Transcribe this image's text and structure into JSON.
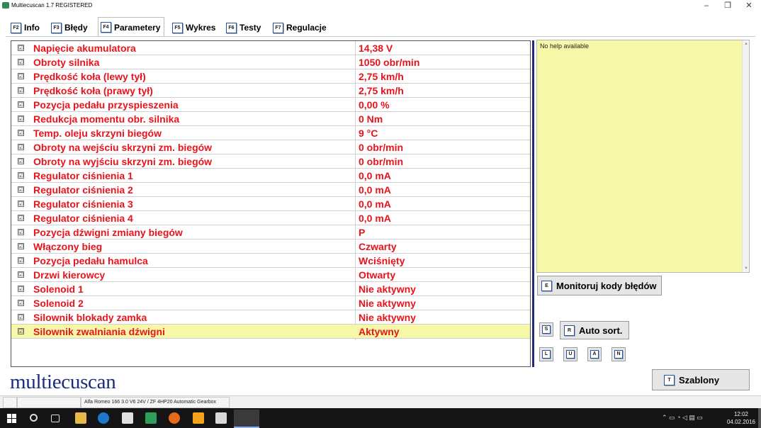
{
  "window": {
    "title": "Multiecuscan 1.7 REGISTERED",
    "minimize": "–",
    "maximize": "❐",
    "close": "✕"
  },
  "tabs": [
    {
      "key": "F2",
      "label": "Info"
    },
    {
      "key": "F3",
      "label": "Błędy"
    },
    {
      "key": "F4",
      "label": "Parametery"
    },
    {
      "key": "F5",
      "label": "Wykres"
    },
    {
      "key": "F6",
      "label": "Testy"
    },
    {
      "key": "F7",
      "label": "Regulacje"
    }
  ],
  "active_tab": "Parametery",
  "checkbox_glyph": "☑",
  "parameters": [
    {
      "name": "Napięcie akumulatora",
      "value": "14,38 V"
    },
    {
      "name": "Obroty silnika",
      "value": "1050 obr/min"
    },
    {
      "name": "Prędkość koła (lewy tył)",
      "value": "2,75 km/h"
    },
    {
      "name": "Prędkość koła (prawy tył)",
      "value": "2,75 km/h"
    },
    {
      "name": "Pozycja pedału przyspieszenia",
      "value": "0,00 %"
    },
    {
      "name": "Redukcja momentu obr. silnika",
      "value": "0 Nm"
    },
    {
      "name": "Temp. oleju skrzyni biegów",
      "value": "9 °C"
    },
    {
      "name": "Obroty na wejściu skrzyni zm. biegów",
      "value": "0 obr/min"
    },
    {
      "name": "Obroty na wyjściu skrzyni zm. biegów",
      "value": "0 obr/min"
    },
    {
      "name": "Regulator ciśnienia 1",
      "value": "0,0 mA"
    },
    {
      "name": "Regulator ciśnienia 2",
      "value": "0,0 mA"
    },
    {
      "name": "Regulator ciśnienia 3",
      "value": "0,0 mA"
    },
    {
      "name": "Regulator ciśnienia 4",
      "value": "0,0 mA"
    },
    {
      "name": "Pozycja dźwigni zmiany biegów",
      "value": "P"
    },
    {
      "name": "Włączony bieg",
      "value": "Czwarty"
    },
    {
      "name": "Pozycja pedału hamulca",
      "value": "Wciśnięty"
    },
    {
      "name": "Drzwi kierowcy",
      "value": "Otwarty"
    },
    {
      "name": "Solenoid 1",
      "value": "Nie aktywny"
    },
    {
      "name": "Solenoid 2",
      "value": "Nie aktywny"
    },
    {
      "name": "Silownik blokady zamka",
      "value": "Nie aktywny"
    },
    {
      "name": "Silownik zwalniania dźwigni",
      "value": "Aktywny"
    }
  ],
  "selected_row": 20,
  "help": {
    "text": "No help available",
    "scroll_up": "▲",
    "scroll_down": "▼"
  },
  "buttons": {
    "monitor": {
      "key": "E",
      "label": "Monitoruj kody błędów"
    },
    "s": {
      "key": "S"
    },
    "auto_sort": {
      "key": "R",
      "label": "Auto sort."
    },
    "l": {
      "key": "L"
    },
    "u": {
      "key": "U"
    },
    "a": {
      "key": "A"
    },
    "n": {
      "key": "N"
    },
    "templates": {
      "key": "T",
      "label": "Szablony"
    }
  },
  "logo": "multiecuscan",
  "status": {
    "vehicle": "Alfa Romeo 166 3.0 V6 24V / ZF 4HP20 Automatic Gearbox"
  },
  "taskbar": {
    "time": "12:02",
    "date": "04.02.2016"
  },
  "colors": {
    "param_text": "#e8131b",
    "help_bg": "#f7f7a8",
    "logo": "#1a2d7c",
    "splitter": "#1f2a7a"
  }
}
